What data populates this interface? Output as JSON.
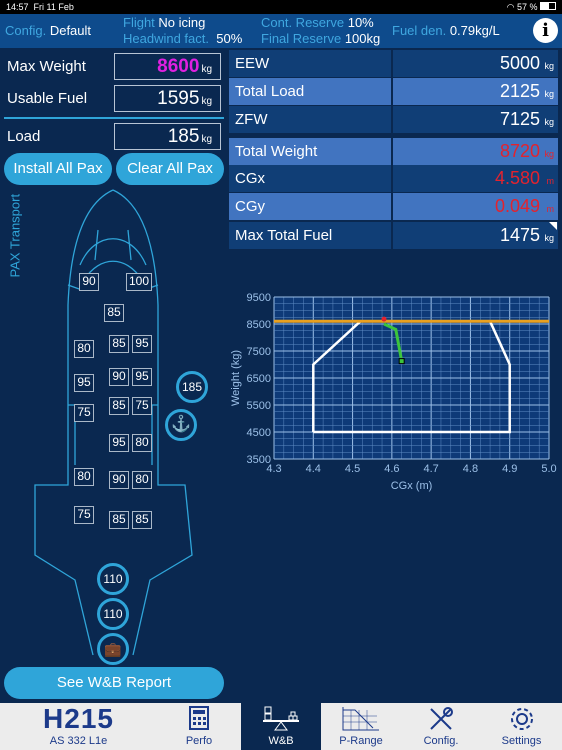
{
  "status": {
    "time": "14:57",
    "date": "Fri 11 Feb",
    "battery": "57 %"
  },
  "header": {
    "config_label": "Config.",
    "config_value": "Default",
    "flight_label": "Flight",
    "flight_value": "No icing",
    "headwind_label": "Headwind fact.",
    "headwind_value": "50%",
    "cont_label": "Cont. Reserve",
    "cont_value": "10%",
    "final_label": "Final Reserve",
    "final_value": "100kg",
    "fuel_label": "Fuel den.",
    "fuel_value": "0.79kg/L",
    "info_icon": "info-icon"
  },
  "inputs": {
    "max_weight_label": "Max Weight",
    "max_weight": "8600",
    "usable_fuel_label": "Usable Fuel",
    "usable_fuel": "1595",
    "load_label": "Load",
    "load": "185",
    "unit": "kg"
  },
  "buttons": {
    "install": "Install All Pax",
    "clear": "Clear All Pax",
    "report": "See W&B Report"
  },
  "mode_label": "PAX Transport",
  "summary": [
    {
      "label": "EEW",
      "value": "5000",
      "unit": "kg"
    },
    {
      "label": "Total Load",
      "value": "2125",
      "unit": "kg"
    },
    {
      "label": "ZFW",
      "value": "7125",
      "unit": "kg"
    },
    {
      "label": "Total Weight",
      "value": "8720",
      "unit": "kg"
    },
    {
      "label": "CGx",
      "value": "4.580",
      "unit": "m"
    },
    {
      "label": "CGy",
      "value": "0.049",
      "unit": "m"
    },
    {
      "label": "Max Total Fuel",
      "value": "1475",
      "unit": "kg"
    }
  ],
  "seats": [
    "90",
    "100",
    "85",
    "80",
    "85",
    "95",
    "95",
    "90",
    "95",
    "75",
    "85",
    "75",
    "95",
    "80",
    "80",
    "90",
    "80",
    "75",
    "85",
    "85"
  ],
  "stations": {
    "hoist_load": "185",
    "rear1": "110",
    "rear2": "110"
  },
  "colors": {
    "alert": "#e3232e",
    "max_weight": "#e020e0",
    "envelope": "#ffffff",
    "max_line": "#e8a020",
    "path": "#3cc43c"
  },
  "chart_data": {
    "type": "line",
    "xlabel": "CGx (m)",
    "ylabel": "Weight (kg)",
    "xlim": [
      4.3,
      5.0
    ],
    "ylim": [
      3500,
      9500
    ],
    "xticks": [
      "4.3",
      "4.4",
      "4.5",
      "4.6",
      "4.7",
      "4.8",
      "4.9",
      "5.0"
    ],
    "yticks": [
      "3500",
      "4500",
      "5500",
      "6500",
      "7500",
      "8500",
      "9500"
    ],
    "grid": true,
    "envelope": {
      "x": [
        4.4,
        4.4,
        4.52,
        4.85,
        4.9,
        4.9,
        4.4
      ],
      "y": [
        4500,
        7000,
        8600,
        8600,
        7000,
        4500,
        4500
      ]
    },
    "max_weight": 8600,
    "cg_path": {
      "x": [
        4.58,
        4.61,
        4.625
      ],
      "y": [
        8500,
        8300,
        7125
      ]
    },
    "current_point": {
      "x": 4.58,
      "y": 8680
    }
  },
  "tabs": [
    {
      "label": "AS 332 L1e",
      "logo": "H215"
    },
    {
      "label": "Perfo"
    },
    {
      "label": "W&B",
      "active": true
    },
    {
      "label": "P-Range"
    },
    {
      "label": "Config."
    },
    {
      "label": "Settings"
    }
  ]
}
